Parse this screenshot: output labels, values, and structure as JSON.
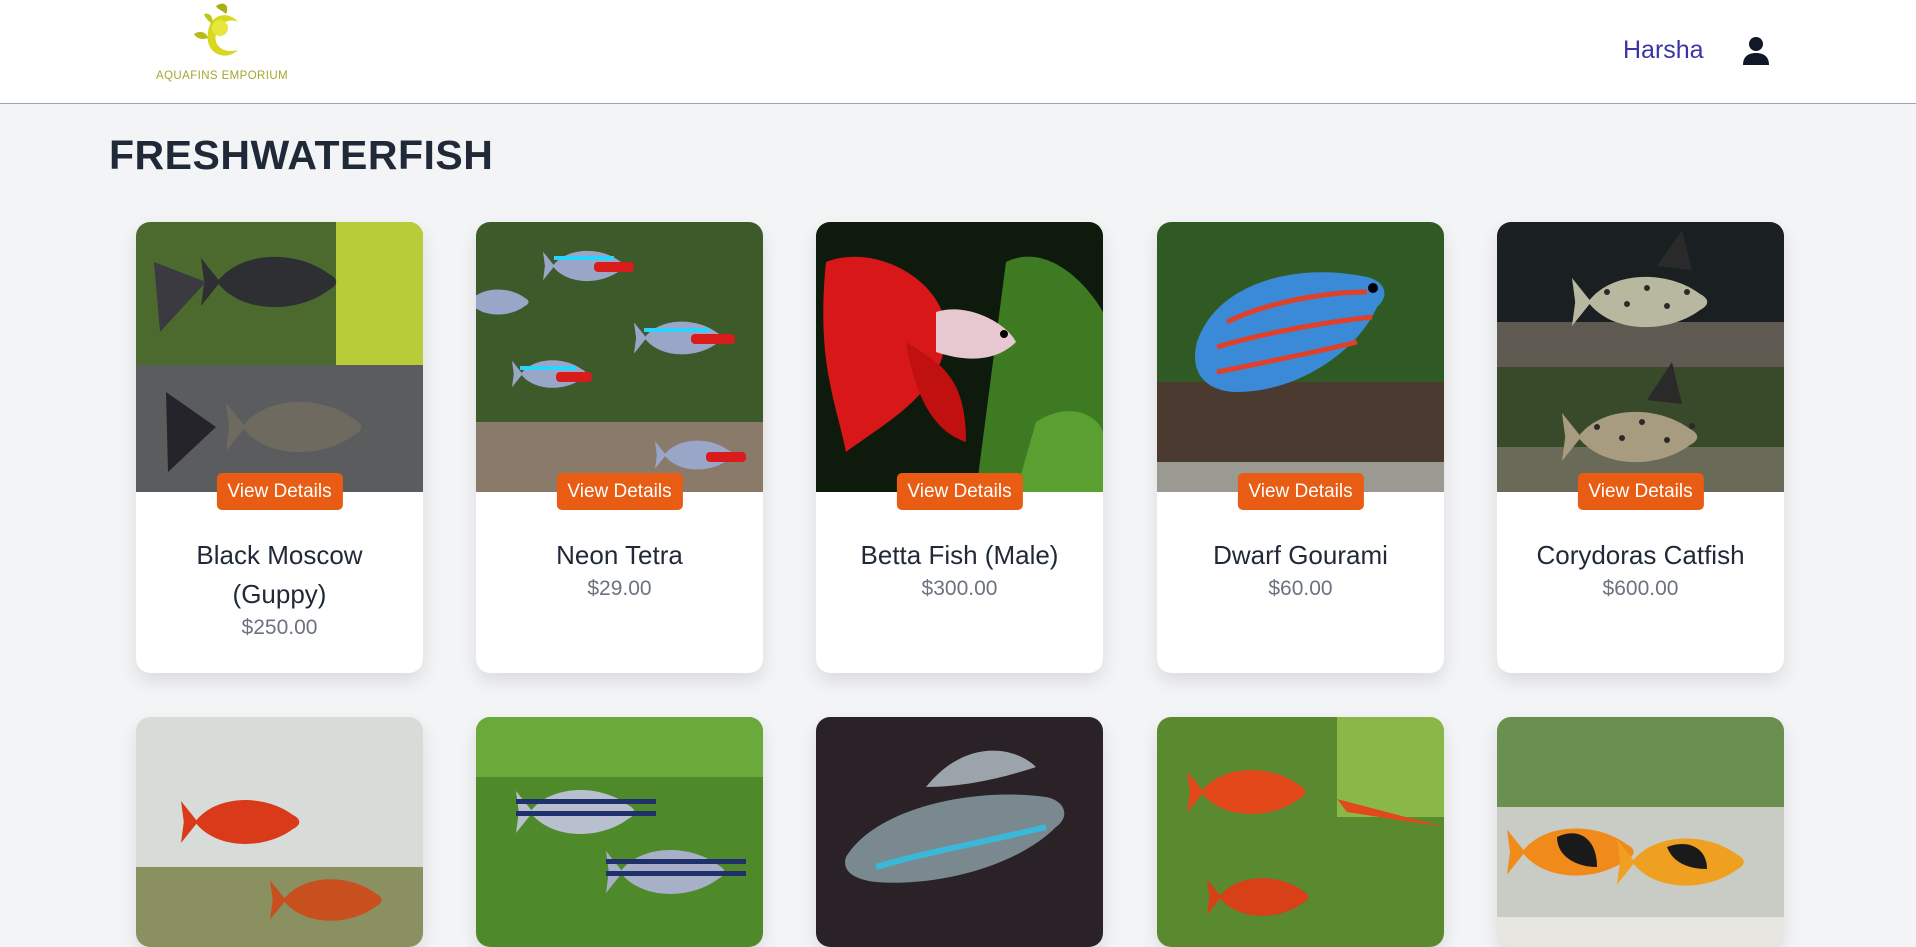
{
  "header": {
    "logo_text": "AQUAFINS EMPORIUM",
    "user_name": "Harsha",
    "user_icon": "user-icon"
  },
  "page": {
    "title": "FRESHWATERFISH"
  },
  "colors": {
    "accent": "#e85d13",
    "user_link": "#3b34a6",
    "background": "#f3f4f6"
  },
  "products": [
    {
      "name": "Black Moscow (Guppy)",
      "price": "$250.00",
      "button": "View Details"
    },
    {
      "name": "Neon Tetra",
      "price": "$29.00",
      "button": "View Details"
    },
    {
      "name": "Betta Fish (Male)",
      "price": "$300.00",
      "button": "View Details"
    },
    {
      "name": "Dwarf Gourami",
      "price": "$60.00",
      "button": "View Details"
    },
    {
      "name": "Corydoras Catfish",
      "price": "$600.00",
      "button": "View Details"
    }
  ]
}
